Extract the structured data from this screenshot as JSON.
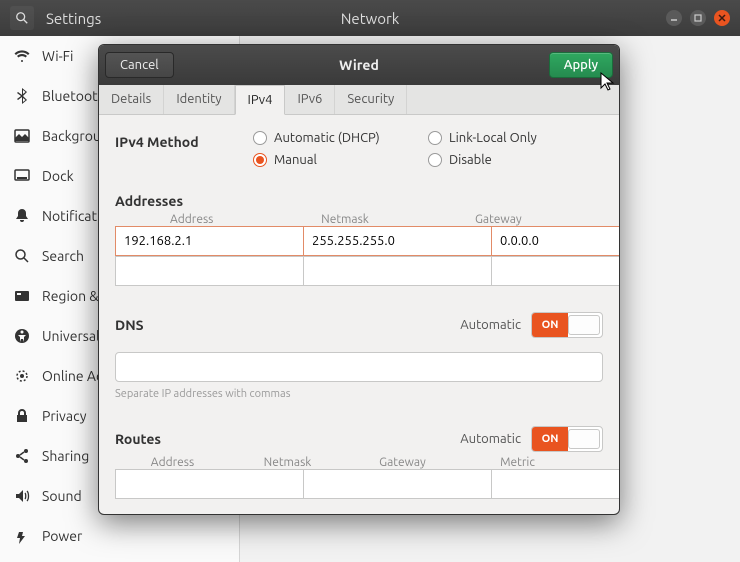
{
  "titlebar": {
    "app_title": "Settings",
    "page_title": "Network"
  },
  "sidebar": {
    "items": [
      {
        "label": "Wi-Fi"
      },
      {
        "label": "Bluetooth"
      },
      {
        "label": "Background"
      },
      {
        "label": "Dock"
      },
      {
        "label": "Notifications"
      },
      {
        "label": "Search"
      },
      {
        "label": "Region & Language"
      },
      {
        "label": "Universal Access"
      },
      {
        "label": "Online Accounts"
      },
      {
        "label": "Privacy"
      },
      {
        "label": "Sharing"
      },
      {
        "label": "Sound"
      },
      {
        "label": "Power"
      }
    ]
  },
  "dialog": {
    "cancel": "Cancel",
    "apply": "Apply",
    "title": "Wired",
    "tabs": [
      "Details",
      "Identity",
      "IPv4",
      "IPv6",
      "Security"
    ],
    "active_tab": "IPv4",
    "method_label": "IPv4 Method",
    "methods": [
      {
        "label": "Automatic (DHCP)",
        "checked": false
      },
      {
        "label": "Link-Local Only",
        "checked": false
      },
      {
        "label": "Manual",
        "checked": true
      },
      {
        "label": "Disable",
        "checked": false
      }
    ],
    "addresses": {
      "title": "Addresses",
      "cols": [
        "Address",
        "Netmask",
        "Gateway"
      ],
      "rows": [
        {
          "address": "192.168.2.1",
          "netmask": "255.255.255.0",
          "gateway": "0.0.0.0",
          "focused": true
        },
        {
          "address": "",
          "netmask": "",
          "gateway": "",
          "focused": false
        }
      ]
    },
    "dns": {
      "title": "DNS",
      "automatic_label": "Automatic",
      "switch": "ON",
      "value": "",
      "helper": "Separate IP addresses with commas"
    },
    "routes": {
      "title": "Routes",
      "automatic_label": "Automatic",
      "switch": "ON",
      "cols": [
        "Address",
        "Netmask",
        "Gateway",
        "Metric"
      ],
      "rows": [
        {
          "address": "",
          "netmask": "",
          "gateway": "",
          "metric": ""
        }
      ]
    }
  }
}
